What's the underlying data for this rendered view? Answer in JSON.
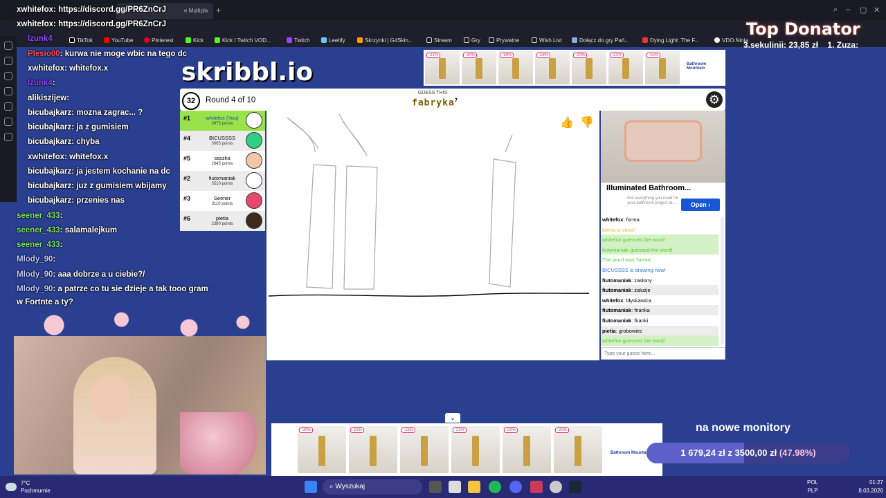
{
  "browser": {
    "tab_title": "xwhitefox : https://discord.gg/PR6ZnCrJ",
    "tab_suffix": "e Multipla",
    "bookmarks": [
      "TikTok",
      "YouTube",
      "Pinterest",
      "Kick",
      "Kick / Twitch VOD...",
      "Twitch",
      "Leetify",
      "Skrzynki | G4Skin...",
      "Stream",
      "Gry",
      "Prywatne",
      "Wish List",
      "Dołącz do gry Pań...",
      "Dying Light: The F...",
      "VDO.Ninja"
    ]
  },
  "stream_chat": [
    {
      "user": "xwhitefox",
      "text": ": https://discord.gg/PR6ZnCrJ",
      "color": "#ffffff"
    },
    {
      "user": "xwhitefox",
      "text": ": https://discord.gg/PR6ZnCrJ",
      "color": "#ffffff"
    },
    {
      "user": "Izunk4",
      "text": "",
      "color": "#9146ff"
    },
    {
      "user": "Plesio00",
      "text": ": kurwa nie moge wbic na tego dc",
      "color": "#ff4d4d"
    },
    {
      "user": "xwhitefox",
      "text": ": whitefox.x",
      "color": "#ffffff"
    },
    {
      "user": "Izunk4",
      "text": ":",
      "color": "#9146ff"
    },
    {
      "user": "alikiszijew",
      "text": ":",
      "color": "#ffffff"
    },
    {
      "user": "bicubajkarz",
      "text": ": mozna zagrac... ?",
      "color": "#ffffff"
    },
    {
      "user": "bicubajkarz",
      "text": ": ja z gumisiem",
      "color": "#ffffff"
    },
    {
      "user": "bicubajkarz",
      "text": ": chyba",
      "color": "#ffffff"
    },
    {
      "user": "xwhitefox",
      "text": ": whitefox.x",
      "color": "#ffffff"
    },
    {
      "user": "bicubajkarz",
      "text": ": ja jestem kochanie na dc",
      "color": "#ffffff"
    },
    {
      "user": "bicubajkarz",
      "text": ": juz z gumisiem wbijamy",
      "color": "#ffffff"
    },
    {
      "user": "bicubajkarz",
      "text": ": przenies nas",
      "color": "#ffffff"
    },
    {
      "user": "seener_433",
      "text": ":",
      "color": "#7be06b"
    },
    {
      "user": "seener_433",
      "text": ": salamalejkum",
      "color": "#7be06b"
    },
    {
      "user": "seener_433",
      "text": ":",
      "color": "#7be06b"
    },
    {
      "user": "Mlody_90",
      "text": ":",
      "color": "#c0c6ff"
    },
    {
      "user": "Mlody_90",
      "text": ": aaa dobrze a u ciebie?/",
      "color": "#c0c6ff"
    },
    {
      "user": "Mlody_90",
      "text": ": a patrze co tu sie dzieje a tak tooo gram",
      "color": "#c0c6ff"
    },
    {
      "user": "",
      "text": "w Fortnte a ty?",
      "color": "#ffffff"
    }
  ],
  "game": {
    "logo": "skribbl.io",
    "timer": "32",
    "round": "Round 4 of 10",
    "guess_label": "GUESS THIS",
    "word": "fabryka",
    "word_len": "7",
    "players": [
      {
        "rank": "#1",
        "name": "whitefox (You)",
        "points": "3975 points",
        "avatar_color": "#ffffff"
      },
      {
        "rank": "#4",
        "name": "BICUSSSS",
        "points": "3065 points",
        "avatar_color": "#2fd07f"
      },
      {
        "rank": "#5",
        "name": "saszka",
        "points": "2845 points",
        "avatar_color": "#f2c9a4"
      },
      {
        "rank": "#2",
        "name": "fiutomaniak",
        "points": "3510 points",
        "avatar_color": "#ffffff"
      },
      {
        "rank": "#3",
        "name": "Seener",
        "points": "3110 points",
        "avatar_color": "#e8486c"
      },
      {
        "rank": "#6",
        "name": "pietia",
        "points": "2380 points",
        "avatar_color": "#3d2a1c"
      }
    ],
    "speech_bubble": "grobowiec",
    "chat": [
      {
        "user": "whitefox",
        "text": "forma",
        "kind": "normal"
      },
      {
        "user": "",
        "text": "forma is close!",
        "kind": "close"
      },
      {
        "user": "",
        "text": "whitefox guessed the word!",
        "kind": "guessed"
      },
      {
        "user": "",
        "text": "fiutomaniak guessed the word!",
        "kind": "guessed"
      },
      {
        "user": "",
        "text": "The word was 'farma'",
        "kind": "info"
      },
      {
        "user": "",
        "text": "BICUSSSS is drawing now!",
        "kind": "draw"
      },
      {
        "user": "fiutomaniak",
        "text": "zasłony",
        "kind": "normal"
      },
      {
        "user": "fiutomaniak",
        "text": "zaluzje",
        "kind": "normal"
      },
      {
        "user": "whitefox",
        "text": "błyskawica",
        "kind": "normal"
      },
      {
        "user": "fiutomaniak",
        "text": "firanka",
        "kind": "normal"
      },
      {
        "user": "fiutomaniak",
        "text": "firanki",
        "kind": "normal"
      },
      {
        "user": "pietia",
        "text": "grobowiec",
        "kind": "normal"
      },
      {
        "user": "",
        "text": "whitefox guessed the word!",
        "kind": "guessed"
      }
    ],
    "input_placeholder": "Type your guess here..."
  },
  "ads": {
    "top_discounts": [
      "-21%",
      "-30%",
      "-16%",
      "-16%",
      "-20%",
      "-21%",
      "-15%"
    ],
    "side_title": "Illuminated Bathroom...",
    "side_sub": "Get everything you need for your bathroom project at...",
    "side_open": "Open",
    "bottom_discounts": [
      "-30%",
      "-16%",
      "-16%",
      "-21%",
      "-20%",
      "-20%"
    ],
    "brand": "Bathroom Mountain"
  },
  "overlays": {
    "top_donator_title": "Top Donator",
    "donator_1": "3.sekulinii: 23,85 zł",
    "donator_2": "1. Zuza:",
    "goal_title": "na nowe monitory",
    "goal_amount": "1 679,24 zł",
    "goal_sep": "z",
    "goal_target": "3500,00 zł",
    "goal_pct": "(47.98%)",
    "goal_fraction": 0.4798
  },
  "taskbar": {
    "temp": "7°C",
    "weather": "Pochmurnie",
    "search": "Wyszukaj",
    "lang1": "POL",
    "lang2": "PLP",
    "time": "01:27",
    "date": "8.03.2026"
  }
}
